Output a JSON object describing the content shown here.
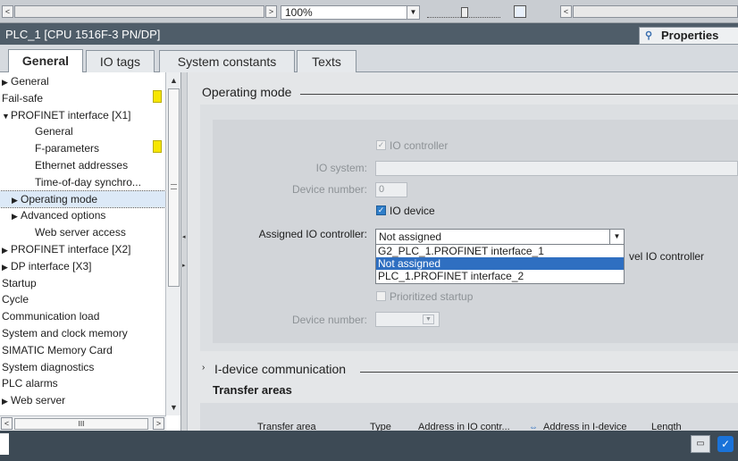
{
  "top": {
    "zoom_value": "100%"
  },
  "window": {
    "title": "PLC_1 [CPU 1516F-3 PN/DP]",
    "properties_label": "Properties"
  },
  "tabs": [
    {
      "label": "General",
      "active": true
    },
    {
      "label": "IO tags",
      "active": false
    },
    {
      "label": "System constants",
      "active": false
    },
    {
      "label": "Texts",
      "active": false
    }
  ],
  "nav": {
    "items": [
      {
        "label": "General",
        "arrow": "▶",
        "indent": 0
      },
      {
        "label": "Fail-safe",
        "arrow": "",
        "indent": 0
      },
      {
        "label": "PROFINET interface [X1]",
        "arrow": "▼",
        "indent": 0
      },
      {
        "label": "General",
        "arrow": "",
        "indent": 2
      },
      {
        "label": "F-parameters",
        "arrow": "",
        "indent": 2
      },
      {
        "label": "Ethernet addresses",
        "arrow": "",
        "indent": 2
      },
      {
        "label": "Time-of-day synchro...",
        "arrow": "",
        "indent": 2
      },
      {
        "label": "Operating mode",
        "arrow": "▶",
        "indent": 1,
        "selected": true
      },
      {
        "label": "Advanced options",
        "arrow": "▶",
        "indent": 1
      },
      {
        "label": "Web server access",
        "arrow": "",
        "indent": 2
      },
      {
        "label": "PROFINET interface [X2]",
        "arrow": "▶",
        "indent": 0
      },
      {
        "label": "DP interface [X3]",
        "arrow": "▶",
        "indent": 0
      },
      {
        "label": "Startup",
        "arrow": "",
        "indent": 0
      },
      {
        "label": "Cycle",
        "arrow": "",
        "indent": 0
      },
      {
        "label": "Communication load",
        "arrow": "",
        "indent": 0
      },
      {
        "label": "System and clock memory",
        "arrow": "",
        "indent": 0
      },
      {
        "label": "SIMATIC Memory Card",
        "arrow": "",
        "indent": 0
      },
      {
        "label": "System diagnostics",
        "arrow": "",
        "indent": 0
      },
      {
        "label": "PLC alarms",
        "arrow": "",
        "indent": 0
      },
      {
        "label": "Web server",
        "arrow": "▶",
        "indent": 0
      }
    ],
    "hscroll_label": "III"
  },
  "main": {
    "section_operating_mode": "Operating mode",
    "io_controller_label": "IO controller",
    "io_system_label": "IO system:",
    "device_number_label": "Device number:",
    "device_number_value": "0",
    "io_device_label": "IO device",
    "assigned_io_controller_label": "Assigned IO controller:",
    "assigned_io_controller_value": "Not assigned",
    "dropdown_options": [
      "G2_PLC_1.PROFINET interface_1",
      "Not assigned",
      "PLC_1.PROFINET interface_2"
    ],
    "partial_text_right": "vel IO controller",
    "prioritized_startup_label": "Prioritized startup",
    "device_number_label_2": "Device number:",
    "section_idevice": "I-device communication",
    "transfer_areas_title": "Transfer areas",
    "table_columns": [
      "Transfer area",
      "Type",
      "Address in IO contr...",
      "Address in I-device",
      "Length"
    ]
  },
  "colors": {
    "accent": "#2f6fc1",
    "titlebar": "#4f5d69",
    "marker": "#f7e600"
  }
}
